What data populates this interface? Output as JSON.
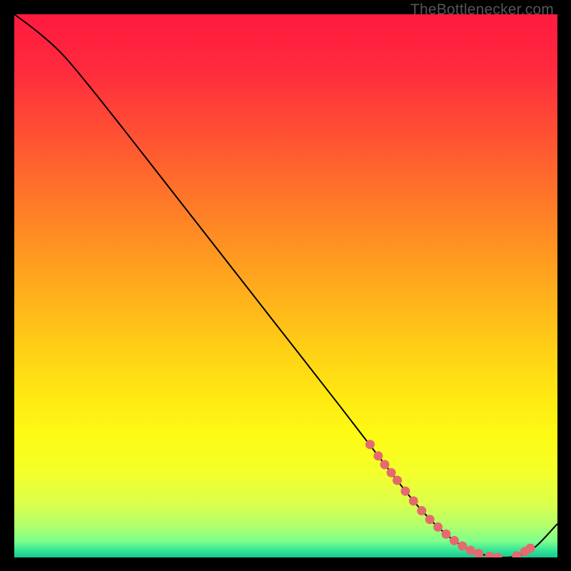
{
  "attribution": "TheBottlenecker.com",
  "chart_data": {
    "type": "line",
    "title": "",
    "xlabel": "",
    "ylabel": "",
    "xlim": [
      0,
      100
    ],
    "ylim": [
      0,
      100
    ],
    "gradient_stops": [
      {
        "offset": 0.0,
        "color": "#ff1a3f"
      },
      {
        "offset": 0.1,
        "color": "#ff2a3e"
      },
      {
        "offset": 0.22,
        "color": "#ff5033"
      },
      {
        "offset": 0.35,
        "color": "#ff7a28"
      },
      {
        "offset": 0.48,
        "color": "#ffa41e"
      },
      {
        "offset": 0.6,
        "color": "#ffca17"
      },
      {
        "offset": 0.7,
        "color": "#ffe812"
      },
      {
        "offset": 0.78,
        "color": "#fdfb15"
      },
      {
        "offset": 0.84,
        "color": "#f5ff2a"
      },
      {
        "offset": 0.9,
        "color": "#dcff4a"
      },
      {
        "offset": 0.94,
        "color": "#b4ff6b"
      },
      {
        "offset": 0.97,
        "color": "#7fff8c"
      },
      {
        "offset": 0.987,
        "color": "#34e597"
      },
      {
        "offset": 1.0,
        "color": "#17c98f"
      }
    ],
    "series": [
      {
        "name": "bottleneck-curve",
        "x": [
          0,
          4,
          8,
          12,
          20,
          30,
          40,
          50,
          60,
          66,
          70,
          74,
          78,
          82,
          86,
          90,
          93,
          96,
          100
        ],
        "y": [
          100,
          97,
          93.5,
          89,
          79,
          66.2,
          53.4,
          40.6,
          27.8,
          20,
          14.8,
          9.8,
          5.6,
          2.4,
          0.6,
          0.0,
          0.4,
          2.0,
          6.2
        ],
        "color": "#000000",
        "stroke_width": 2
      }
    ],
    "markers": {
      "name": "highlight-dots",
      "color": "#e46a6f",
      "radius": 6.5,
      "points_x": [
        65.5,
        67.0,
        68.2,
        69.4,
        70.5,
        72.0,
        73.5,
        75.0,
        76.5,
        78.0,
        79.5,
        81.0,
        82.5,
        84.0,
        85.5,
        87.5,
        89.0,
        92.5,
        94.0,
        95.0
      ],
      "points_y": [
        20.8,
        18.7,
        17.1,
        15.6,
        14.2,
        12.2,
        10.4,
        8.6,
        7.0,
        5.6,
        4.3,
        3.1,
        2.1,
        1.3,
        0.7,
        0.2,
        0.0,
        0.3,
        1.1,
        1.7
      ]
    }
  }
}
